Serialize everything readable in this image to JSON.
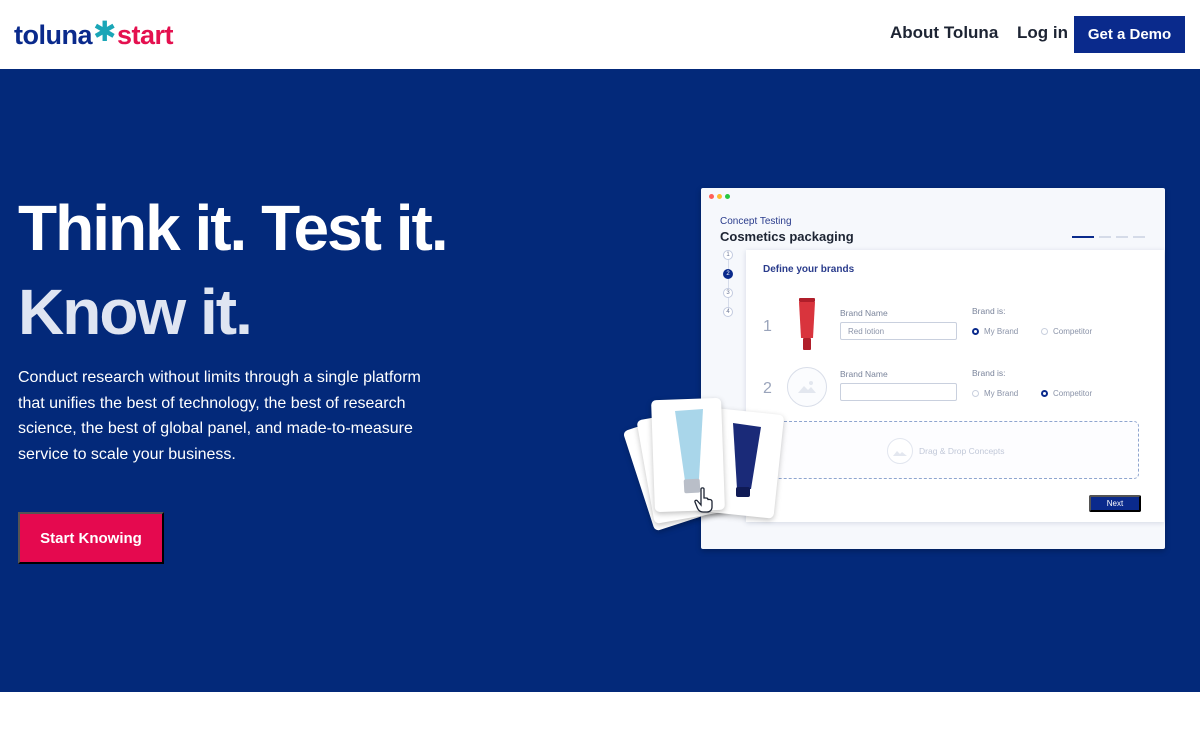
{
  "header": {
    "logo": {
      "word1": "toluna",
      "word2": "start"
    },
    "nav": {
      "about": "About Toluna",
      "login": "Log in",
      "demo": "Get a Demo"
    }
  },
  "hero": {
    "headline1": "Think it. Test it.",
    "headline2": "Know it.",
    "description": "Conduct research without limits through a single platform that unifies the best of technology, the best of research science, the best of global panel, and made-to-measure service to scale your business.",
    "cta": "Start Knowing"
  },
  "mockup": {
    "eyebrow": "Concept Testing",
    "title": "Cosmetics packaging",
    "steps": [
      "1",
      "2",
      "3",
      "4"
    ],
    "active_step": 2,
    "panel_title": "Define your brands",
    "rows": [
      {
        "number": "1",
        "brand_label": "Brand Name",
        "brand_value": "Red lotion",
        "brand_is_label": "Brand is:",
        "option1": "My Brand",
        "option2": "Competitor",
        "selected": "My Brand"
      },
      {
        "number": "2",
        "brand_label": "Brand Name",
        "brand_value": "",
        "brand_is_label": "Brand is:",
        "option1": "My Brand",
        "option2": "Competitor",
        "selected": "Competitor"
      }
    ],
    "drop_label": "Drag & Drop Concepts",
    "next": "Next"
  },
  "colors": {
    "brand_navy": "#0a2a8c",
    "hero_bg": "#03297a",
    "accent_pink": "#e5094f",
    "logo_teal": "#1aa6b7"
  }
}
